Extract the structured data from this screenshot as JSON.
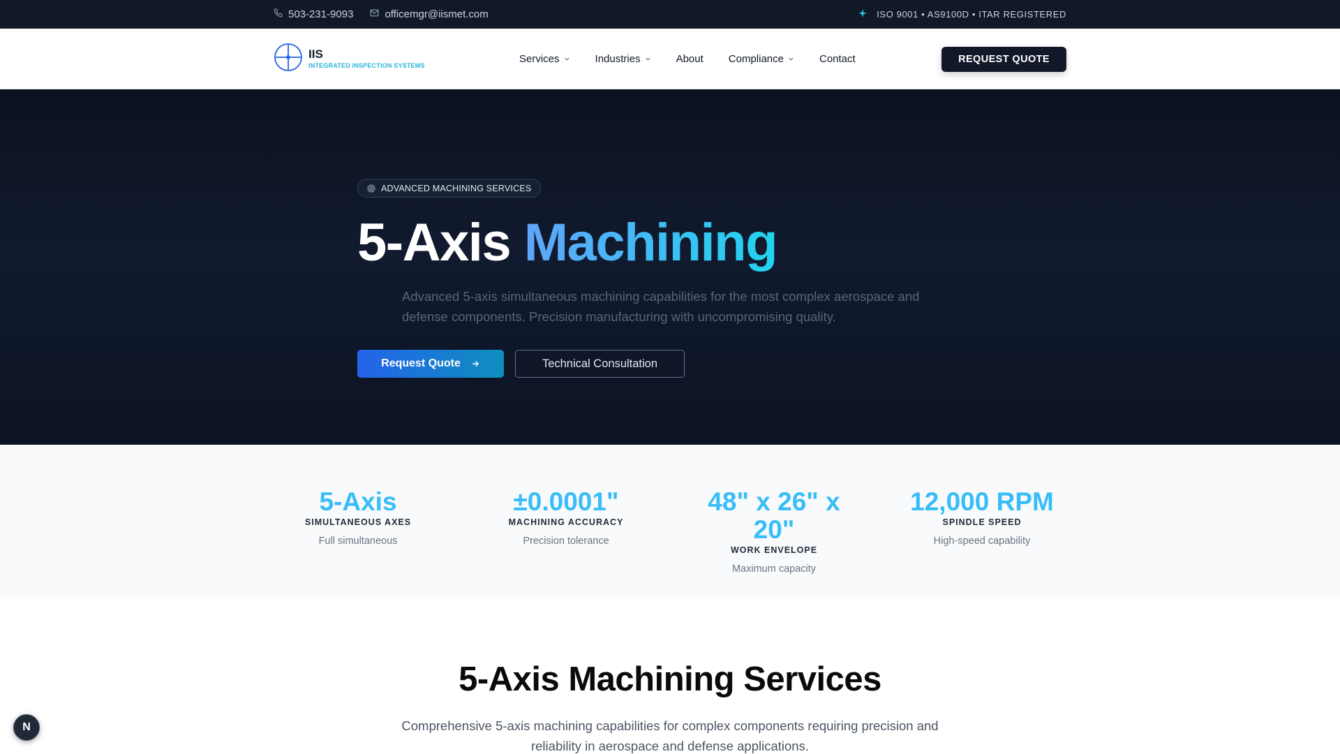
{
  "topbar": {
    "phone": "503-231-9093",
    "email": "officemgr@iismet.com",
    "certifications": "ISO 9001 • AS9100D • ITAR REGISTERED"
  },
  "nav": {
    "logo_title": "IIS",
    "logo_subtitle": "INTEGRATED INSPECTION SYSTEMS",
    "items": [
      {
        "label": "Services",
        "dropdown": true
      },
      {
        "label": "Industries",
        "dropdown": true
      },
      {
        "label": "About",
        "dropdown": false
      },
      {
        "label": "Compliance",
        "dropdown": true
      },
      {
        "label": "Contact",
        "dropdown": false
      }
    ],
    "cta": "REQUEST QUOTE"
  },
  "hero": {
    "badge": "ADVANCED MACHINING SERVICES",
    "title_part1": "5-Axis",
    "title_part2": "Machining",
    "description": "Advanced 5-axis simultaneous machining capabilities for the most complex aerospace and defense components. Precision manufacturing with uncompromising quality.",
    "primary_button": "Request Quote",
    "secondary_button": "Technical Consultation"
  },
  "stats": [
    {
      "value": "5-Axis",
      "label": "SIMULTANEOUS AXES",
      "desc": "Full simultaneous"
    },
    {
      "value": "±0.0001\"",
      "label": "MACHINING ACCURACY",
      "desc": "Precision tolerance"
    },
    {
      "value": "48\" x 26\" x 20\"",
      "label": "WORK ENVELOPE",
      "desc": "Maximum capacity"
    },
    {
      "value": "12,000 RPM",
      "label": "SPINDLE SPEED",
      "desc": "High-speed capability"
    }
  ],
  "section": {
    "title": "5-Axis Machining Services",
    "description": "Comprehensive 5-axis machining capabilities for complex components requiring precision and reliability in aerospace and defense applications."
  },
  "floating_badge": "N",
  "colors": {
    "topbar_bg": "#111827",
    "accent_cyan": "#38bdf8",
    "primary_blue": "#2563eb",
    "hero_bg": "#0b1120"
  }
}
